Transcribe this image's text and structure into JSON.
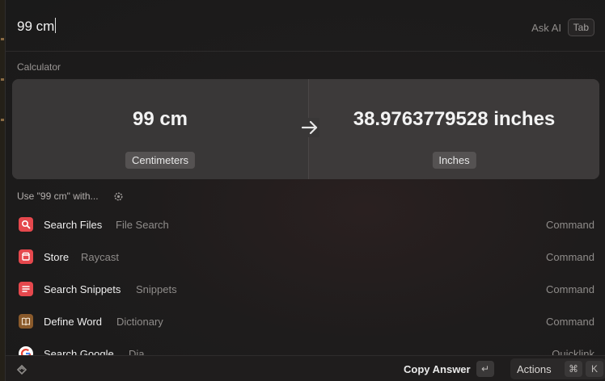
{
  "search": {
    "query": "99 cm",
    "ask_ai": "Ask AI",
    "tab_key": "Tab"
  },
  "calculator": {
    "section_title": "Calculator",
    "from_value": "99 cm",
    "from_unit": "Centimeters",
    "to_value": "38.9763779528 inches",
    "to_unit": "Inches"
  },
  "use_with": {
    "label": "Use \"99 cm\" with..."
  },
  "items": [
    {
      "title": "Search Files",
      "subtitle": "File Search",
      "accessory": "Command",
      "icon": "search-files-icon",
      "color": "#e5484d"
    },
    {
      "title": "Store",
      "subtitle": "Raycast",
      "accessory": "Command",
      "icon": "store-icon",
      "color": "#e5484d"
    },
    {
      "title": "Search Snippets",
      "subtitle": "Snippets",
      "accessory": "Command",
      "icon": "snippets-icon",
      "color": "#e5484d"
    },
    {
      "title": "Define Word",
      "subtitle": "Dictionary",
      "accessory": "Command",
      "icon": "dictionary-icon",
      "color": "#8a5a2b"
    },
    {
      "title": "Search Google",
      "subtitle": "Dia",
      "accessory": "Quicklink",
      "icon": "google-icon",
      "color": "#ffffff"
    }
  ],
  "footer": {
    "primary_action": "Copy Answer",
    "enter_key": "↵",
    "actions_label": "Actions",
    "cmd_key": "⌘",
    "k_key": "K"
  }
}
